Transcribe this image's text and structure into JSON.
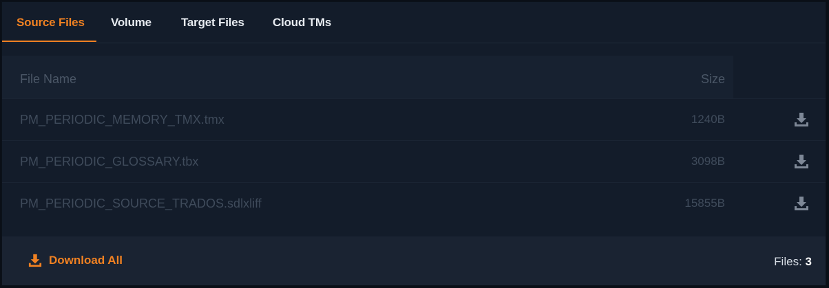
{
  "tabs": [
    {
      "label": "Source Files",
      "active": true
    },
    {
      "label": "Volume",
      "active": false
    },
    {
      "label": "Target Files",
      "active": false
    },
    {
      "label": "Cloud TMs",
      "active": false
    }
  ],
  "table": {
    "columns": {
      "name": "File Name",
      "size": "Size"
    },
    "rows": [
      {
        "name": "PM_PERIODIC_MEMORY_TMX.tmx",
        "size": "1240B"
      },
      {
        "name": "PM_PERIODIC_GLOSSARY.tbx",
        "size": "3098B"
      },
      {
        "name": "PM_PERIODIC_SOURCE_TRADOS.sdlxliff",
        "size": "15855B"
      }
    ]
  },
  "footer": {
    "download_all_label": "Download All",
    "files_label": "Files:",
    "files_count": "3"
  },
  "icons": {
    "row_action": "download-icon",
    "download_all": "download-icon"
  },
  "colors": {
    "accent": "#f08122",
    "background": "#131c2a"
  }
}
